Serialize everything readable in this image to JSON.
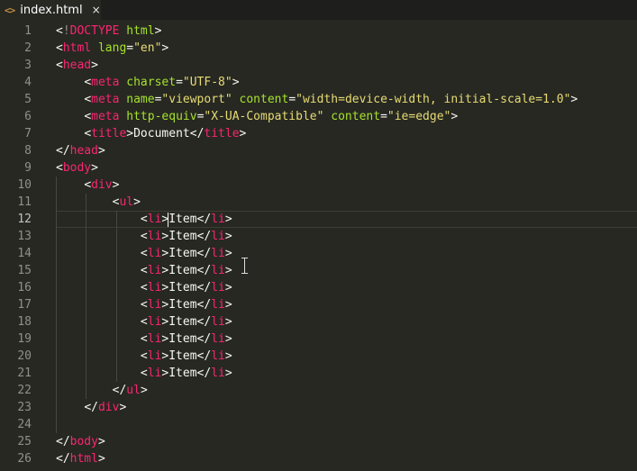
{
  "tab": {
    "icon": "<>",
    "icon_name": "code-file-icon",
    "title": "index.html",
    "close": "×"
  },
  "colors": {
    "background": "#272822",
    "tag": "#f92672",
    "attribute": "#a6e22e",
    "string": "#e6db74",
    "text": "#f8f8f2",
    "line_number": "#90908a"
  },
  "editor": {
    "current_line": 12,
    "lines": [
      {
        "n": "1",
        "code": "<!DOCTYPE html>"
      },
      {
        "n": "2",
        "code": "<html lang=\"en\">"
      },
      {
        "n": "3",
        "code": "<head>"
      },
      {
        "n": "4",
        "code": "    <meta charset=\"UTF-8\">"
      },
      {
        "n": "5",
        "code": "    <meta name=\"viewport\" content=\"width=device-width, initial-scale=1.0\">"
      },
      {
        "n": "6",
        "code": "    <meta http-equiv=\"X-UA-Compatible\" content=\"ie=edge\">"
      },
      {
        "n": "7",
        "code": "    <title>Document</title>"
      },
      {
        "n": "8",
        "code": "</head>"
      },
      {
        "n": "9",
        "code": "<body>"
      },
      {
        "n": "10",
        "code": "    <div>"
      },
      {
        "n": "11",
        "code": "        <ul>"
      },
      {
        "n": "12",
        "code": "            <li>Item</li>"
      },
      {
        "n": "13",
        "code": "            <li>Item</li>"
      },
      {
        "n": "14",
        "code": "            <li>Item</li>"
      },
      {
        "n": "15",
        "code": "            <li>Item</li>"
      },
      {
        "n": "16",
        "code": "            <li>Item</li>"
      },
      {
        "n": "17",
        "code": "            <li>Item</li>"
      },
      {
        "n": "18",
        "code": "            <li>Item</li>"
      },
      {
        "n": "19",
        "code": "            <li>Item</li>"
      },
      {
        "n": "20",
        "code": "            <li>Item</li>"
      },
      {
        "n": "21",
        "code": "            <li>Item</li>"
      },
      {
        "n": "22",
        "code": "        </ul>"
      },
      {
        "n": "23",
        "code": "    </div>"
      },
      {
        "n": "24",
        "code": ""
      },
      {
        "n": "25",
        "code": "</body>"
      },
      {
        "n": "26",
        "code": "</html>"
      }
    ]
  }
}
